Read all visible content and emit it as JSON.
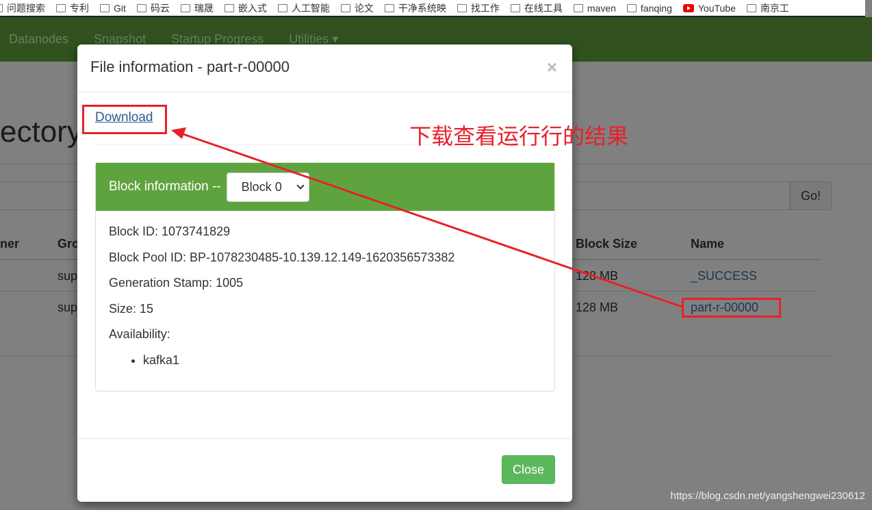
{
  "bookmarks": [
    "问题搜索",
    "专利",
    "Git",
    "码云",
    "瑞晟",
    "嵌入式",
    "人工智能",
    "论文",
    "干净系统映",
    "找工作",
    "在线工具",
    "maven",
    "fanqing",
    "YouTube",
    "南京工"
  ],
  "navbar": [
    "Datanodes",
    "Snapshot",
    "Startup Progress",
    "Utilities ▾"
  ],
  "background": {
    "title_fragment": "ectory",
    "go_label": "Go!",
    "headers": [
      "ner",
      "Gro",
      "Block Size",
      "Name"
    ],
    "rows": [
      {
        "group": "sup",
        "block_size": "128 MB",
        "name": "_SUCCESS"
      },
      {
        "group": "sup",
        "block_size": "128 MB",
        "name": "part-r-00000"
      }
    ]
  },
  "modal": {
    "title": "File information - part-r-00000",
    "close_x": "×",
    "download": "Download",
    "panel": {
      "heading": "Block information --",
      "select_value": "Block 0",
      "block_id": "Block ID: 1073741829",
      "pool_id": "Block Pool ID: BP-1078230485-10.139.12.149-1620356573382",
      "gen_stamp": "Generation Stamp: 1005",
      "size": "Size: 15",
      "availability": "Availability:",
      "nodes": [
        "kafka1"
      ]
    },
    "close_label": "Close"
  },
  "annotation": {
    "text": "下载查看运行行的结果",
    "color": "#e8202a"
  },
  "watermark": "https://blog.csdn.net/yangshengwei230612"
}
